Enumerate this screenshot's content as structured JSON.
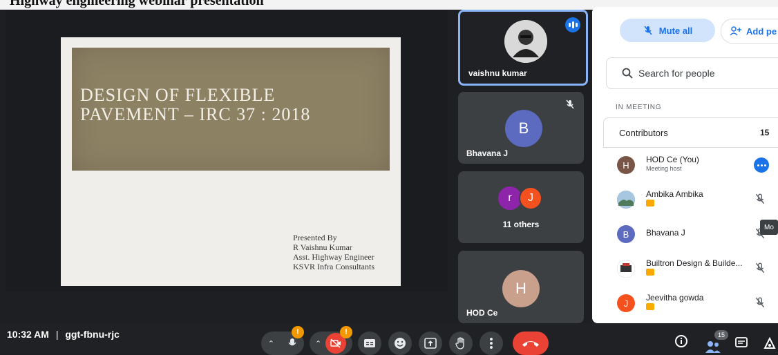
{
  "page_header_text": "Highway engineering webinar presentation",
  "slide": {
    "title": "Design of Flexible Pavement – IRC 37 : 2018",
    "credits": [
      "Presented By",
      "R Vaishnu Kumar",
      "Asst. Highway Engineer",
      "KSVR Infra Consultants"
    ]
  },
  "tiles": [
    {
      "name": "vaishnu kumar"
    },
    {
      "name": "Bhavana J",
      "initial": "B"
    },
    {
      "name": "11 others",
      "initials": [
        "r",
        "J"
      ]
    },
    {
      "name": "HOD Ce",
      "initial": "H"
    }
  ],
  "panel": {
    "mute_all": "Mute all",
    "add_people": "Add pe",
    "search_placeholder": "Search for people",
    "section": "IN MEETING",
    "group_label": "Contributors",
    "group_count": "15",
    "people": [
      {
        "initial": "H",
        "name": "HOD Ce (You)",
        "sub": "Meeting host",
        "color": "#795548"
      },
      {
        "initial": "",
        "name": "Ambika Ambika",
        "color": "#6d8aa6"
      },
      {
        "initial": "B",
        "name": "Bhavana J",
        "color": "#5c6bc0"
      },
      {
        "initial": "",
        "name": "Builtron Design & Builde...",
        "color": "#333333"
      },
      {
        "initial": "J",
        "name": "Jeevitha gowda",
        "color": "#f4511e"
      }
    ],
    "tooltip": "Mo"
  },
  "bottom": {
    "time": "10:32 AM",
    "separator": "|",
    "meeting_code": "ggt-fbnu-rjc",
    "warning": "!",
    "participants_count": "15"
  },
  "colors": {
    "accent": "#1a73e8",
    "danger": "#ea4335",
    "warning": "#f29900",
    "speaking_border": "#8ab4f8"
  }
}
